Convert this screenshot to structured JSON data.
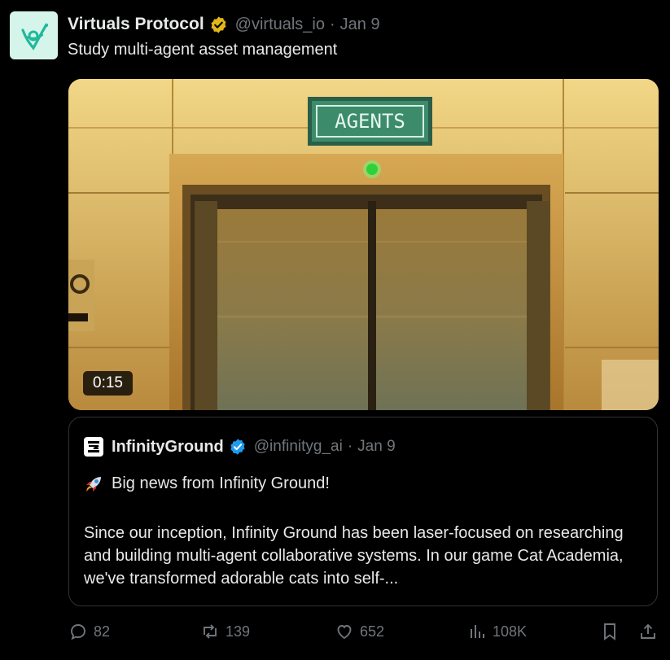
{
  "tweet": {
    "author_name": "Virtuals Protocol",
    "handle": "@virtuals_io",
    "separator": "·",
    "date": "Jan 9",
    "text": "Study multi-agent asset management",
    "avatar_icon": "virtuals-logo",
    "verified_badge_color": "#e2b719"
  },
  "media": {
    "sign_text": "AGENTS",
    "duration": "0:15"
  },
  "quote": {
    "author_name": "InfinityGround",
    "handle": "@infinityg_ai",
    "separator": "·",
    "date": "Jan 9",
    "verified_badge_color": "#1d9bf0",
    "headline": "Big news from Infinity Ground!",
    "headline_icon": "rocket-emoji",
    "body": "Since our inception, Infinity Ground has been laser-focused on researching and building multi-agent collaborative systems. In our game Cat Academia, we've transformed adorable cats into self-..."
  },
  "actions": {
    "replies": "82",
    "reposts": "139",
    "likes": "652",
    "views": "108K"
  }
}
